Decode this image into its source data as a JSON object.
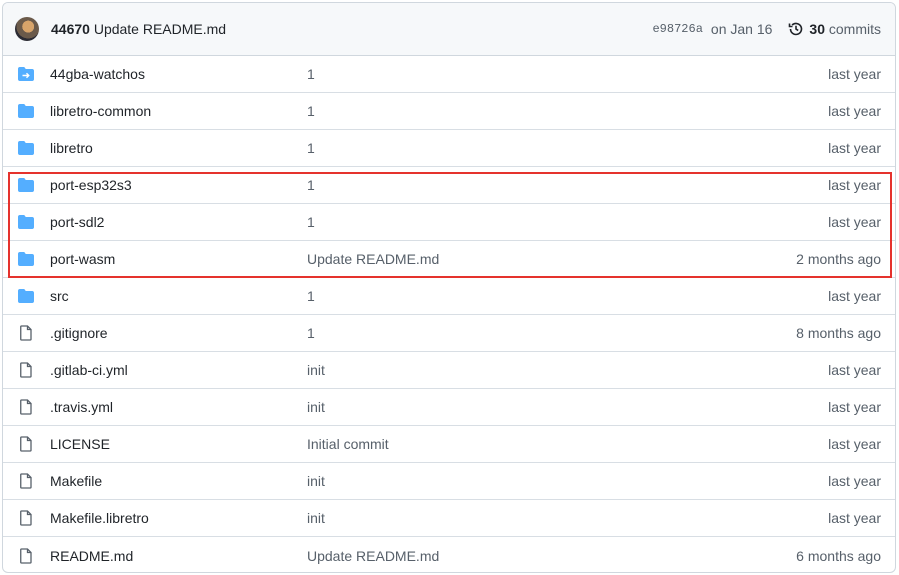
{
  "header": {
    "author": "44670",
    "message": "Update README.md",
    "sha": "e98726a",
    "date": "on Jan 16",
    "commits_count": "30",
    "commits_label": "commits"
  },
  "colors": {
    "folder": "#54aeff",
    "highlight": "#e5322d"
  },
  "files": [
    {
      "type": "submodule",
      "name": "44gba-watchos",
      "message": "1",
      "age": "last year"
    },
    {
      "type": "folder",
      "name": "libretro-common",
      "message": "1",
      "age": "last year"
    },
    {
      "type": "folder",
      "name": "libretro",
      "message": "1",
      "age": "last year"
    },
    {
      "type": "folder",
      "name": "port-esp32s3",
      "message": "1",
      "age": "last year"
    },
    {
      "type": "folder",
      "name": "port-sdl2",
      "message": "1",
      "age": "last year"
    },
    {
      "type": "folder",
      "name": "port-wasm",
      "message": "Update README.md",
      "age": "2 months ago"
    },
    {
      "type": "folder",
      "name": "src",
      "message": "1",
      "age": "last year"
    },
    {
      "type": "file",
      "name": ".gitignore",
      "message": "1",
      "age": "8 months ago"
    },
    {
      "type": "file",
      "name": ".gitlab-ci.yml",
      "message": "init",
      "age": "last year"
    },
    {
      "type": "file",
      "name": ".travis.yml",
      "message": "init",
      "age": "last year"
    },
    {
      "type": "file",
      "name": "LICENSE",
      "message": "Initial commit",
      "age": "last year"
    },
    {
      "type": "file",
      "name": "Makefile",
      "message": "init",
      "age": "last year"
    },
    {
      "type": "file",
      "name": "Makefile.libretro",
      "message": "init",
      "age": "last year"
    },
    {
      "type": "file",
      "name": "README.md",
      "message": "Update README.md",
      "age": "6 months ago"
    }
  ]
}
